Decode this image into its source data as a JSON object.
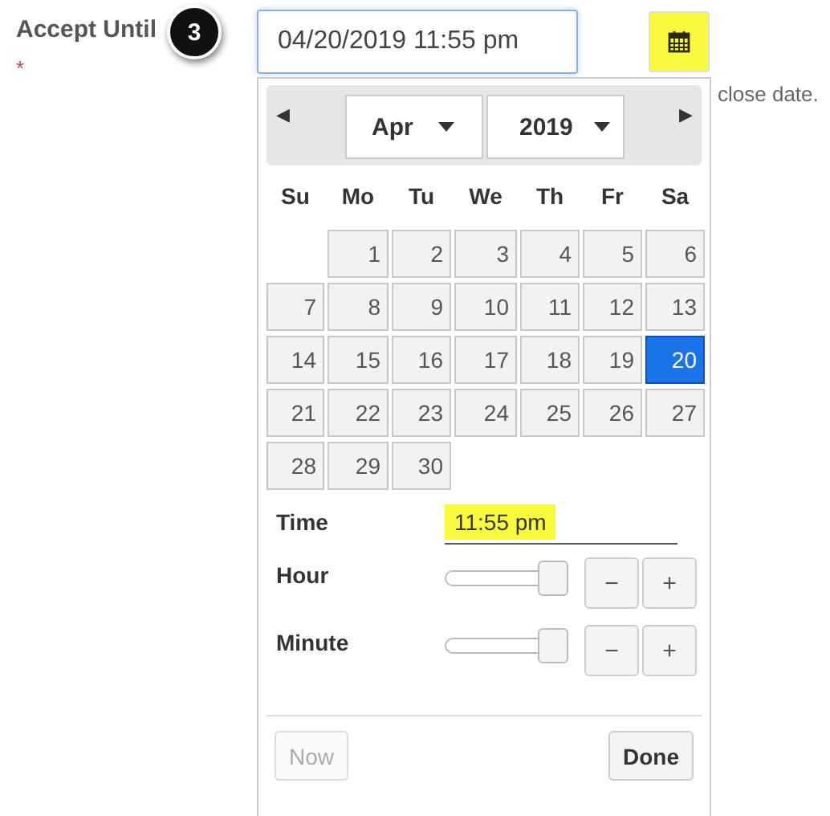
{
  "field": {
    "label": "Accept Until",
    "required_mark": "*",
    "step_badge": "3",
    "value": "04/20/2019 11:55 pm"
  },
  "help_text": "close date.",
  "datepicker": {
    "prev": "◀",
    "next": "▶",
    "month": "Apr",
    "year": "2019",
    "weekdays": [
      "Su",
      "Mo",
      "Tu",
      "We",
      "Th",
      "Fr",
      "Sa"
    ],
    "weeks": [
      {
        "days": [
          {
            "label": "1",
            "selected": false
          },
          {
            "label": "2",
            "selected": false
          },
          {
            "label": "3",
            "selected": false
          },
          {
            "label": "4",
            "selected": false
          },
          {
            "label": "5",
            "selected": false
          },
          {
            "label": "6",
            "selected": false
          }
        ]
      },
      {
        "days": [
          {
            "label": "7",
            "selected": false
          },
          {
            "label": "8",
            "selected": false
          },
          {
            "label": "9",
            "selected": false
          },
          {
            "label": "10",
            "selected": false
          },
          {
            "label": "11",
            "selected": false
          },
          {
            "label": "12",
            "selected": false
          },
          {
            "label": "13",
            "selected": false
          }
        ]
      },
      {
        "days": [
          {
            "label": "14",
            "selected": false
          },
          {
            "label": "15",
            "selected": false
          },
          {
            "label": "16",
            "selected": false
          },
          {
            "label": "17",
            "selected": false
          },
          {
            "label": "18",
            "selected": false
          },
          {
            "label": "19",
            "selected": false
          },
          {
            "label": "20",
            "selected": true
          }
        ]
      },
      {
        "days": [
          {
            "label": "21",
            "selected": false
          },
          {
            "label": "22",
            "selected": false
          },
          {
            "label": "23",
            "selected": false
          },
          {
            "label": "24",
            "selected": false
          },
          {
            "label": "25",
            "selected": false
          },
          {
            "label": "26",
            "selected": false
          },
          {
            "label": "27",
            "selected": false
          }
        ]
      },
      {
        "days": [
          {
            "label": "28",
            "selected": false
          },
          {
            "label": "29",
            "selected": false
          },
          {
            "label": "30",
            "selected": false
          }
        ]
      }
    ],
    "time_label": "Time",
    "time_value": "11:55 pm",
    "sliders": [
      {
        "label": "Hour",
        "level": 1,
        "minus": "−",
        "plus": "+"
      },
      {
        "label": "Minute",
        "level": 1,
        "minus": "−",
        "plus": "+"
      }
    ],
    "buttons": [
      {
        "label": "Now",
        "disabled": true
      },
      {
        "label": "Done",
        "disabled": false
      }
    ]
  }
}
